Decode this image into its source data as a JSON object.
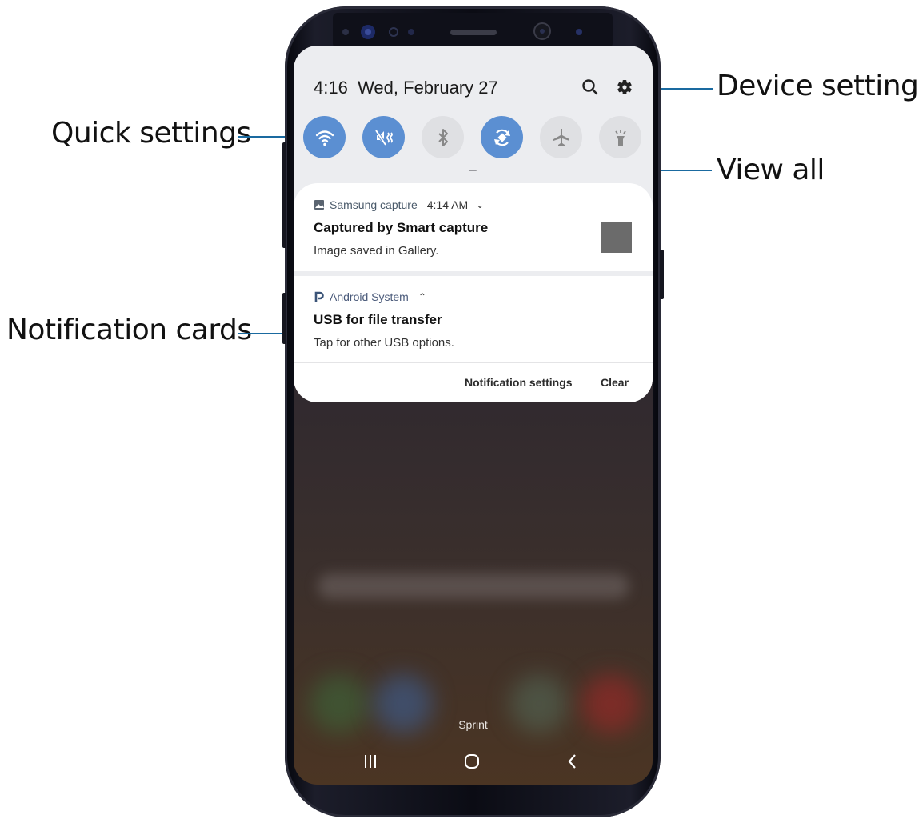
{
  "callouts": {
    "quick_settings": "Quick settings",
    "device_settings": "Device settings",
    "view_all": "View all",
    "notification_cards": "Notification cards"
  },
  "status": {
    "time": "4:16",
    "date": "Wed, February 27"
  },
  "header_icons": [
    "search-icon",
    "gear-icon"
  ],
  "quick_settings": [
    {
      "name": "wifi",
      "state": "on"
    },
    {
      "name": "sound-mute",
      "state": "on"
    },
    {
      "name": "bluetooth",
      "state": "off"
    },
    {
      "name": "auto-rotate",
      "state": "on"
    },
    {
      "name": "airplane-mode",
      "state": "off"
    },
    {
      "name": "flashlight",
      "state": "off"
    }
  ],
  "notifications": [
    {
      "app": "Samsung capture",
      "time": "4:14 AM",
      "expand": "⌄",
      "title": "Captured by Smart capture",
      "body": "Image saved in Gallery."
    },
    {
      "app": "Android System",
      "expand": "⌃",
      "title": "USB for file transfer",
      "body": "Tap for other USB options."
    }
  ],
  "actions": {
    "settings": "Notification settings",
    "clear": "Clear"
  },
  "carrier": "Sprint",
  "nav": [
    "recent-apps-icon",
    "home-icon",
    "back-icon"
  ],
  "colors": {
    "accent": "#5b8fd2",
    "leader": "#1a6aa0",
    "panel": "#ecedf0"
  }
}
